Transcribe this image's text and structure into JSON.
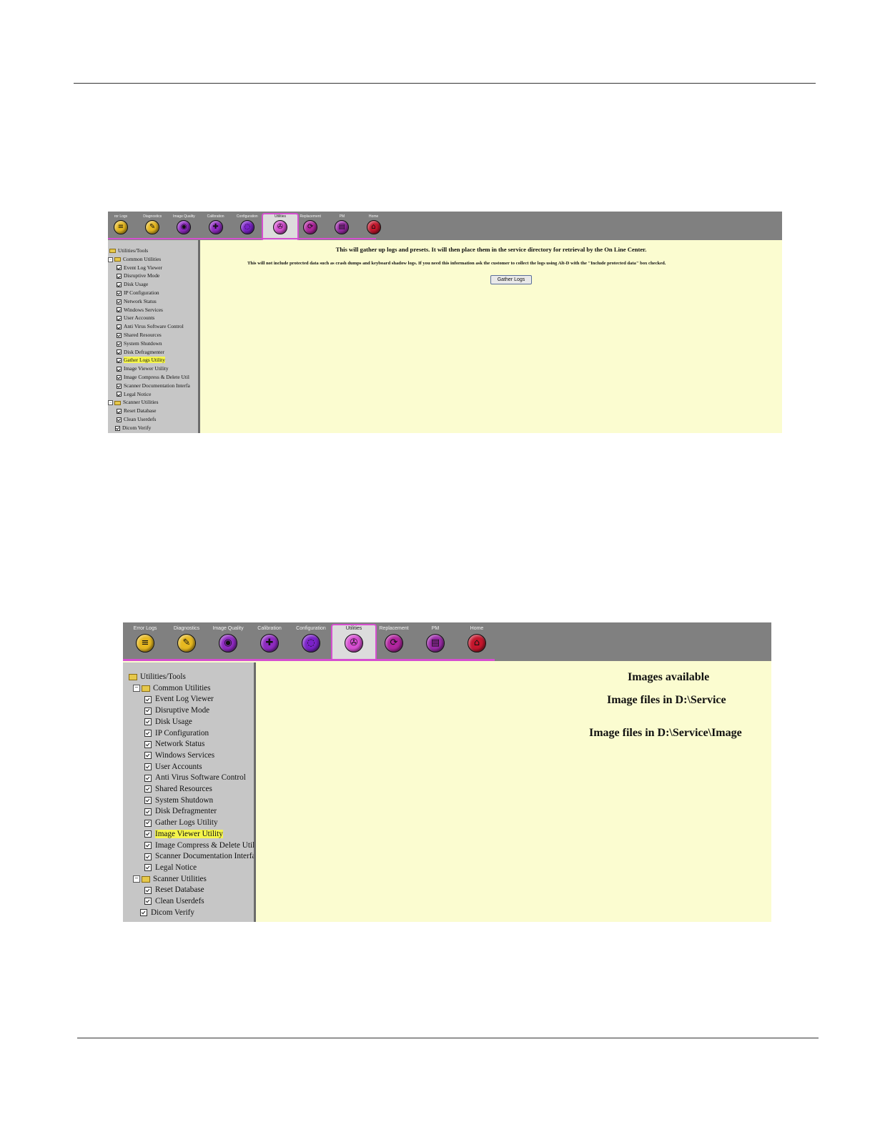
{
  "shot1": {
    "tabs": [
      {
        "label": "Error Logs",
        "shown": "ror Logs",
        "icon": "list-icon",
        "glyph": "≡",
        "color": "#e6b820"
      },
      {
        "label": "Diagnostics",
        "shown": "Diagnostics",
        "icon": "stethoscope-icon",
        "glyph": "✎",
        "color": "#e6b820"
      },
      {
        "label": "Image Quality",
        "shown": "Image Quality",
        "icon": "image-quality-icon",
        "glyph": "◉",
        "color": "#8e2ac0"
      },
      {
        "label": "Calibration",
        "shown": "Calibration",
        "icon": "calibration-icon",
        "glyph": "✚",
        "color": "#8e2ac0"
      },
      {
        "label": "Configuration",
        "shown": "Configuration",
        "icon": "configuration-icon",
        "glyph": "◌",
        "color": "#7a22c8"
      },
      {
        "label": "Utilities",
        "shown": "Utilities",
        "icon": "utilities-icon",
        "glyph": "✇",
        "color": "#d84fd3",
        "active": true
      },
      {
        "label": "Replacement",
        "shown": "Replacement",
        "icon": "replacement-icon",
        "glyph": "⟳",
        "color": "#b0259e"
      },
      {
        "label": "PM",
        "shown": "PM",
        "icon": "pm-icon",
        "glyph": "▤",
        "color": "#9b2aa8"
      },
      {
        "label": "Home",
        "shown": "Home",
        "icon": "home-icon",
        "glyph": "⌂",
        "color": "#c4162c"
      }
    ],
    "tree": {
      "root": "Utilities/Tools",
      "common": "Common Utilities",
      "common_items": [
        "Event Log Viewer",
        "Disruptive Mode",
        "Disk Usage",
        "IP Configuration",
        "Network Status",
        "Windows Services",
        "User Accounts",
        "Anti Virus Software Control",
        "Shared Resources",
        "System Shutdown",
        "Disk Defragmenter",
        "Gather Logs Utility",
        "Image Viewer Utility",
        "Image Compress & Delete Util",
        "Scanner Documentation Interfa",
        "Legal Notice"
      ],
      "scanner": "Scanner Utilities",
      "scanner_items": [
        "Reset Database",
        "Clean Userdefs"
      ],
      "dicom": "Dicom Verify",
      "selected_index": 11
    },
    "main_title": "This will gather up logs and presets. It will then place them in the service directory for retrieval by the On Line Center.",
    "main_note": "This will not include protected data such as crash dumps and keyboard shadow logs. If you need this information ask the customer to collect the logs using Alt-D with the \"Include protected data\" box checked.",
    "button_label": "Gather Logs"
  },
  "shot2": {
    "tabs": [
      {
        "label": "Error Logs",
        "shown": "Error Logs",
        "icon": "list-icon",
        "glyph": "≡",
        "color": "#e6b820"
      },
      {
        "label": "Diagnostics",
        "shown": "Diagnostics",
        "icon": "stethoscope-icon",
        "glyph": "✎",
        "color": "#e6b820"
      },
      {
        "label": "Image Quality",
        "shown": "Image Quality",
        "icon": "image-quality-icon",
        "glyph": "◉",
        "color": "#8e2ac0"
      },
      {
        "label": "Calibration",
        "shown": "Calibration",
        "icon": "calibration-icon",
        "glyph": "✚",
        "color": "#8e2ac0"
      },
      {
        "label": "Configuration",
        "shown": "Configuration",
        "icon": "configuration-icon",
        "glyph": "◌",
        "color": "#7a22c8"
      },
      {
        "label": "Utilities",
        "shown": "Utilities",
        "icon": "utilities-icon",
        "glyph": "✇",
        "color": "#d84fd3",
        "active": true
      },
      {
        "label": "Replacement",
        "shown": "Replacement",
        "icon": "replacement-icon",
        "glyph": "⟳",
        "color": "#b0259e"
      },
      {
        "label": "PM",
        "shown": "PM",
        "icon": "pm-icon",
        "glyph": "▤",
        "color": "#9b2aa8"
      },
      {
        "label": "Home",
        "shown": "Home",
        "icon": "home-icon",
        "glyph": "⌂",
        "color": "#c4162c"
      }
    ],
    "tree": {
      "root": "Utilities/Tools",
      "common": "Common Utilities",
      "common_items": [
        "Event Log Viewer",
        "Disruptive Mode",
        "Disk Usage",
        "IP Configuration",
        "Network Status",
        "Windows Services",
        "User Accounts",
        "Anti Virus Software Control",
        "Shared Resources",
        "System Shutdown",
        "Disk Defragmenter",
        "Gather Logs Utility",
        "Image Viewer Utility",
        "Image Compress & Delete Util",
        "Scanner Documentation Interfa",
        "Legal Notice"
      ],
      "scanner": "Scanner Utilities",
      "scanner_items": [
        "Reset Database",
        "Clean Userdefs"
      ],
      "dicom": "Dicom Verify",
      "selected_index": 12
    },
    "main_title": "Images available",
    "main_line1": "Image files in D:\\Service",
    "main_line2": "Image files in D:\\Service\\Image"
  }
}
